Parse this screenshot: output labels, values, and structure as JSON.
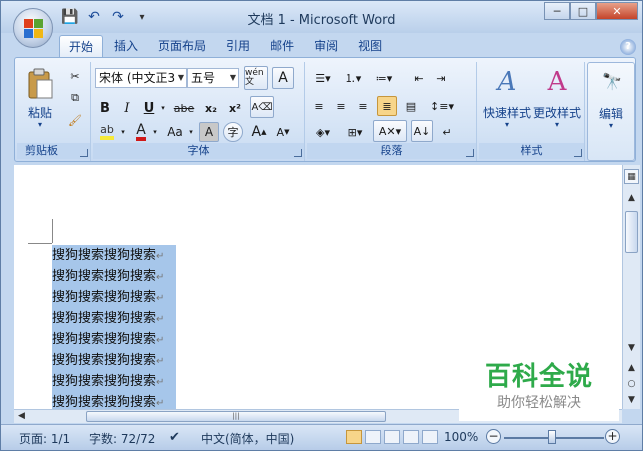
{
  "window": {
    "title": "文档 1 - Microsoft Word"
  },
  "qat": {
    "save": "💾",
    "undo": "↶",
    "redo": "↷",
    "more": "▾"
  },
  "tabs": [
    "开始",
    "插入",
    "页面布局",
    "引用",
    "邮件",
    "审阅",
    "视图"
  ],
  "ribbon": {
    "clipboard": {
      "label": "剪贴板",
      "paste": "粘贴"
    },
    "font": {
      "label": "字体",
      "font_name": "宋体 (中文正3",
      "font_size": "五号",
      "wen": "wén文",
      "A": "A",
      "bold": "B",
      "italic": "I",
      "underline": "U",
      "strike": "abe",
      "sub": "x₂",
      "sup": "x²",
      "case": "Aa",
      "grow": "A",
      "shrink": "A"
    },
    "paragraph": {
      "label": "段落"
    },
    "styles": {
      "label": "样式",
      "quick": "快速样式",
      "change": "更改样式"
    },
    "editing": {
      "label": "编辑"
    }
  },
  "document": {
    "lines": [
      "搜狗搜索搜狗搜索",
      "搜狗搜索搜狗搜索",
      "搜狗搜索搜狗搜索",
      "搜狗搜索搜狗搜索",
      "搜狗搜索搜狗搜索",
      "搜狗搜索搜狗搜索",
      "搜狗搜索搜狗搜索",
      "搜狗搜索搜狗搜索"
    ],
    "para_mark": "↵"
  },
  "watermark": {
    "main": "百科全说",
    "sub": "助你轻松解决"
  },
  "status": {
    "page": "页面: 1/1",
    "words": "字数: 72/72",
    "language": "中文(简体，中国)",
    "zoom": "100%",
    "zoom_level": 1.0
  },
  "colors": {
    "highlight": "#f5e93a",
    "font_color": "#d01818",
    "selection": "#a6c6ea"
  }
}
